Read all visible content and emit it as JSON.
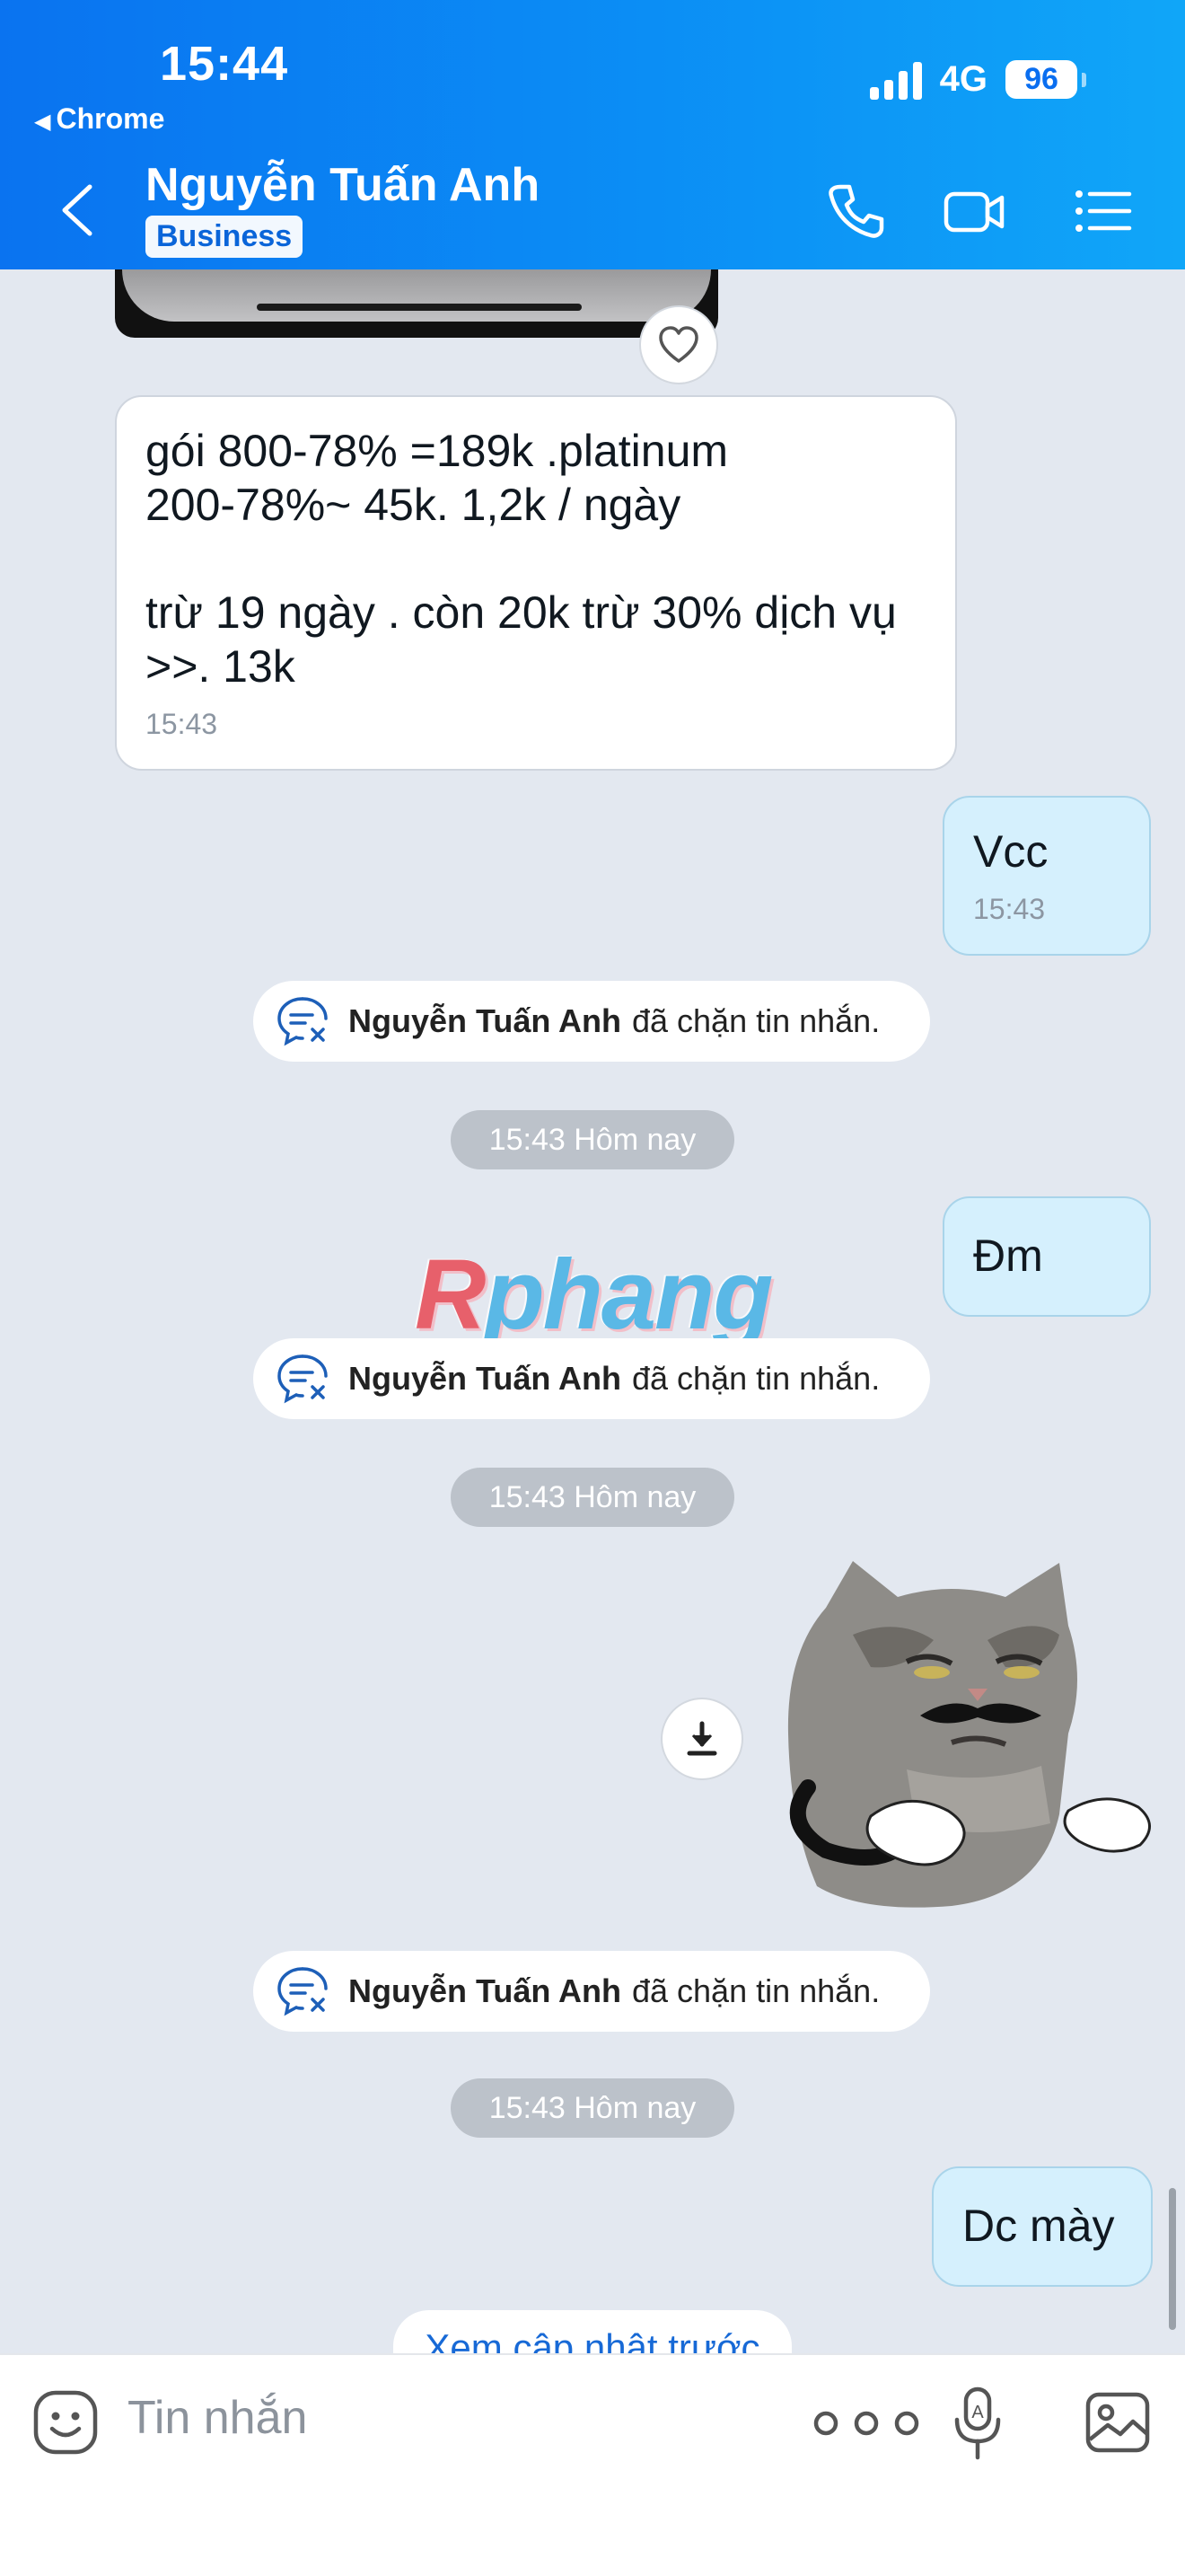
{
  "status_bar": {
    "time": "15:44",
    "back_app": "Chrome",
    "network": "4G",
    "battery": "96"
  },
  "header": {
    "contact_name": "Nguyễn Tuấn Anh",
    "badge": "Business",
    "icons": [
      "back-chevron-icon",
      "phone-icon",
      "video-camera-icon",
      "list-menu-icon"
    ]
  },
  "messages": [
    {
      "direction": "in",
      "text": "gói 800-78% =189k  .platinum\n200-78%~ 45k. 1,2k / ngày\n\ntrừ 19 ngày . còn 20k trừ 30% dịch vụ\n>>. 13k",
      "time": "15:43"
    },
    {
      "direction": "out",
      "text": "Vcc",
      "time": "15:43"
    },
    {
      "direction": "out",
      "text": "Đm"
    },
    {
      "direction": "out",
      "text": "Dc mày"
    }
  ],
  "system_notes": [
    {
      "name": "Nguyễn Tuấn Anh",
      "text": "đã chặn tin nhắn."
    },
    {
      "name": "Nguyễn Tuấn Anh",
      "text": "đã chặn tin nhắn."
    },
    {
      "name": "Nguyễn Tuấn Anh",
      "text": "đã chặn tin nhắn."
    }
  ],
  "time_separators": [
    "15:43 Hôm nay",
    "15:43 Hôm nay",
    "15:43 Hôm nay"
  ],
  "watermark": {
    "first": "R",
    "rest": "phang"
  },
  "load_more": "Xem cập nhật trước",
  "composer": {
    "placeholder": "Tin nhắn",
    "icons": [
      "emoji-icon",
      "more-options-icon",
      "microphone-icon",
      "image-icon"
    ]
  },
  "colors": {
    "header_start": "#0a73f0",
    "header_end": "#10a6f8",
    "chat_background": "#e3e8f0",
    "outgoing_bubble": "#d5f0fd",
    "incoming_bubble": "#ffffff",
    "time_pill": "#bcc2ca",
    "link": "#1769d6"
  }
}
